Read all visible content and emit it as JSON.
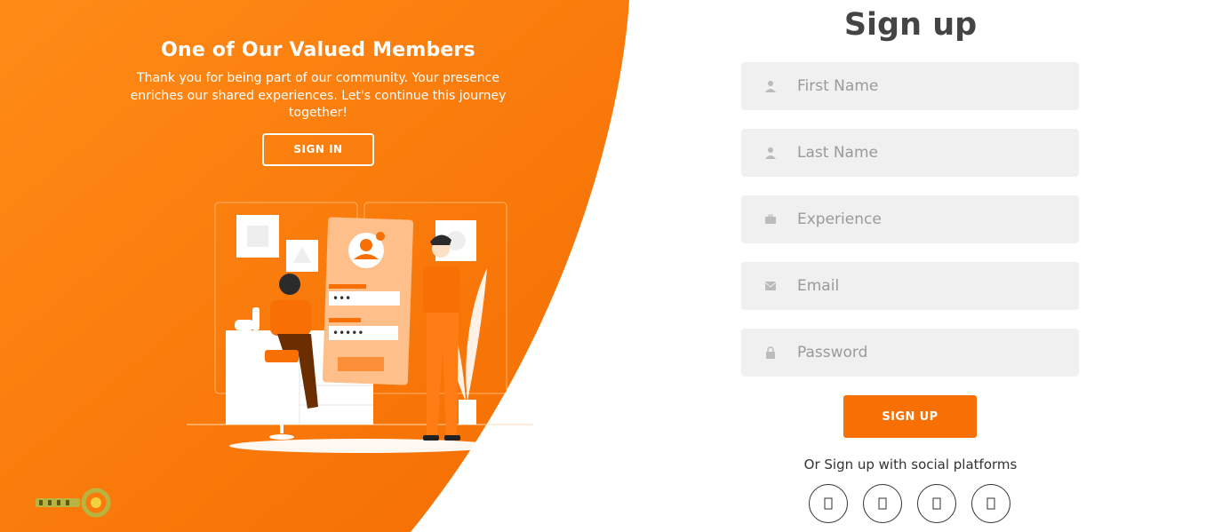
{
  "brand": {
    "accent": "#f86f03",
    "accent_light": "#ffa559",
    "logo_icon": "circle-logo-icon"
  },
  "left_panel": {
    "title": "One of Our Valued Members",
    "text": "Thank you for being part of our community. Your presence enriches our shared experiences. Let's continue this journey together!",
    "signin_label": "SIGN IN",
    "illustration": "login-illustration"
  },
  "signup": {
    "title": "Sign up",
    "fields": [
      {
        "placeholder": "First Name",
        "value": "",
        "icon": "user-icon"
      },
      {
        "placeholder": "Last Name",
        "value": "",
        "icon": "user-icon"
      },
      {
        "placeholder": "Experience",
        "value": "",
        "icon": "briefcase-icon"
      },
      {
        "placeholder": "Email",
        "value": "",
        "icon": "envelope-icon"
      },
      {
        "placeholder": "Password",
        "value": "",
        "icon": "lock-icon"
      }
    ],
    "submit_label": "SIGN UP",
    "social_text": "Or Sign up with social platforms",
    "social": [
      {
        "icon": "facebook-icon"
      },
      {
        "icon": "twitter-icon"
      },
      {
        "icon": "google-icon"
      },
      {
        "icon": "linkedin-icon"
      }
    ]
  }
}
